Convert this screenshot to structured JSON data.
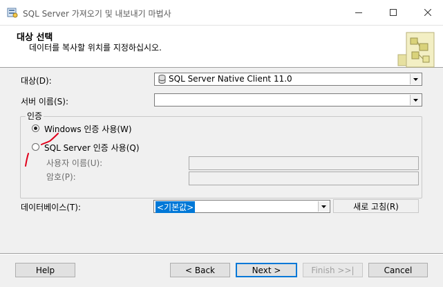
{
  "window": {
    "title": "SQL Server 가져오기 및 내보내기 마법사",
    "icon": "database-wizard-icon"
  },
  "header": {
    "title": "대상 선택",
    "subtitle": "데이터를 복사할 위치를 지정하십시오."
  },
  "form": {
    "destination_label": "대상(D):",
    "destination_value": "SQL Server Native Client 11.0",
    "server_label": "서버 이름(S):",
    "server_value": "",
    "auth_group_label": "인증",
    "windows_auth_label": "Windows 인증 사용(W)",
    "sql_auth_label": "SQL Server 인증 사용(Q)",
    "selected_auth": "windows",
    "username_label": "사용자 이름(U):",
    "password_label": "암호(P):",
    "database_label": "데이터베이스(T):",
    "database_value": "<기본값>",
    "refresh_label": "새로 고침(R)"
  },
  "buttons": {
    "help": "Help",
    "back": "< Back",
    "next": "Next >",
    "finish": "Finish >>|",
    "cancel": "Cancel"
  },
  "colors": {
    "selection": "#0078d7",
    "annotation": "#e0001b"
  }
}
